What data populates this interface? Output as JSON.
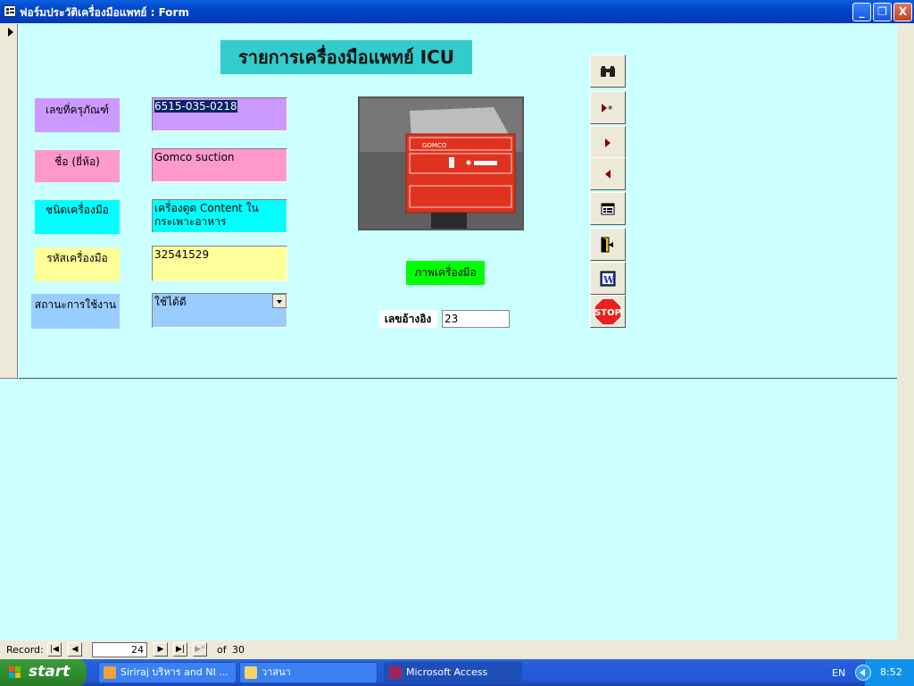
{
  "window": {
    "title": "ฟอร์มประวัติเครื่องมือแพทย์ : Form",
    "minimize_label": "_",
    "restore_label": "❐",
    "close_label": "X"
  },
  "form": {
    "title": "รายการเครื่องมือแพทย์ ICU",
    "fields": {
      "asset_number": {
        "label": "เลขที่ครุภัณฑ์",
        "value": "6515-035-0218"
      },
      "brand": {
        "label": "ชื่อ (ยี่ห้อ)",
        "value": "Gomco suction"
      },
      "device_type": {
        "label": "ชนิดเครื่องมือ",
        "value": "เครื่องดูด Content ในกระเพาะอาหาร"
      },
      "device_code": {
        "label": "รหัสเครื่องมือ",
        "value": "32541529"
      },
      "status": {
        "label": "สถานะการใช้งาน",
        "value": "ใช้ได้ดี"
      }
    },
    "photo_caption": "ภาพเครื่องมือ",
    "reference": {
      "label": "เลขอ้างอิง",
      "value": "23"
    },
    "photo_brand_text": "GOMCO",
    "colors": {
      "title_bg": "#33cccc",
      "purple": "#cc99ff",
      "pink": "#ff99cc",
      "cyan": "#00ffff",
      "yellow": "#ffff99",
      "blue": "#99ccff",
      "green": "#00ff00"
    }
  },
  "toolbar_icons": [
    "binoculars-icon",
    "new-record-icon",
    "next-record-icon",
    "previous-record-icon",
    "form-icon",
    "exit-door-icon",
    "word-icon",
    "stop-sign-icon"
  ],
  "stop_text": "STOP",
  "word_text": "W",
  "record_nav": {
    "label": "Record:",
    "current": "24",
    "of_label": "of",
    "total": "30"
  },
  "taskbar": {
    "start_label": "start",
    "tasks": [
      {
        "label": "Siriraj บริหาร and  NI ..."
      },
      {
        "label": "วาสนา"
      },
      {
        "label": "Microsoft Access"
      }
    ],
    "language": "EN",
    "clock": "8:52"
  }
}
